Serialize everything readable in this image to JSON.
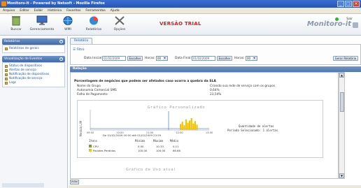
{
  "window": {
    "title": "Monitoro-it - Powered by Netsoft - Mozilla Firefox"
  },
  "menubar": [
    "Arquivo",
    "Editar",
    "Exibir",
    "Histórico",
    "Favoritos",
    "Ferramentas",
    "Ajuda"
  ],
  "toolbar": {
    "buttons": [
      {
        "label": "Buscar",
        "icon": "trash-bin-icon"
      },
      {
        "label": "Gerenciamento",
        "icon": "monitor-icon"
      },
      {
        "label": "WMI",
        "icon": "globe-icon"
      },
      {
        "label": "Relatórios",
        "icon": "pie-chart-icon"
      },
      {
        "label": "Opções",
        "icon": "tools-icon"
      }
    ],
    "trial_text": "VERSÃO TRIAL",
    "brand": "Monitoro-it",
    "user": "Sair"
  },
  "sidebar": {
    "sections": [
      {
        "title": "Relatórios",
        "items": [
          "Relatórios de gerais"
        ]
      },
      {
        "title": "Visualização de Eventos",
        "items": [
          "Status de dispositivos",
          "Alertas de serviço",
          "Notificação de dispositivos",
          "Notificação de serviço",
          "Logs"
        ]
      }
    ]
  },
  "main": {
    "tab": "Relatório",
    "filter": {
      "label": "Filtro",
      "start_label": "Data Inicial:",
      "start_value": "01/02/2009",
      "start_btn": "Escolher",
      "start_hour_label": "Horas:",
      "start_hour": "00",
      "end_label": "Data Final:",
      "end_value": "01/02/2009",
      "end_btn": "Escolher",
      "end_hour_label": "Horas:",
      "end_hour": "00",
      "generate_btn": "Gerar Relatório"
    },
    "result_header": "Relação",
    "section_title": "Porcentagem de negócios que podem ser afetados caso ocorra a quebra da SLA",
    "kv": [
      {
        "k": "Nome do Grupo",
        "v": "Criando sua rede de serviço com os grupos"
      },
      {
        "k": "Autonomia Comercial SMS",
        "v": "0,64%"
      },
      {
        "k": "Falha de Pagamento",
        "v": "23,54%"
      }
    ],
    "footer_btn": "Voltar"
  },
  "chart_data": {
    "type": "bar",
    "title": "Gráfico Personalizado",
    "ylabel": "Medida L/M",
    "x_ticks": [
      "09:00",
      "10:00",
      "11:00",
      "12:00",
      "13:00"
    ],
    "period_line1": "De 01/02/2009 00:00 até  01/02/2009 23:59",
    "table_headers": [
      "Itens",
      "Mínimo",
      "Máximo",
      "Médio"
    ],
    "table_rows": [
      {
        "name": "CPU",
        "color": "#7aa12b",
        "min": "0.00",
        "max": "10.33",
        "avg": "0.11"
      },
      {
        "name": "Pacotes Perdidos",
        "color": "#f1c40f",
        "min": "100.00",
        "max": "100.00",
        "avg": "66.66"
      }
    ],
    "side_text_1": "Quantidade de alertas",
    "side_text_2": "Período Selecionado: 1 alertas",
    "bars": [
      0.5,
      0.7,
      0.4,
      0.9,
      0.6,
      0.8,
      1.0,
      0.55,
      0.75,
      0.45
    ],
    "line_color": "#5b8fd6",
    "bar_color": "#f4c300",
    "ylim": [
      0,
      100
    ]
  },
  "chart2_title": "Gráfico de Uso atual"
}
